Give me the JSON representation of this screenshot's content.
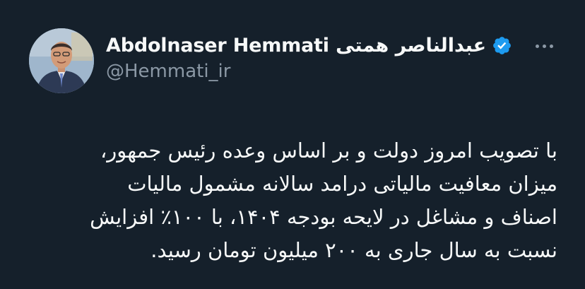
{
  "author": {
    "display_name": "Abdolnaser Hemmati عبدالناصر همتی",
    "handle": "@Hemmati_ir",
    "verified_icon": "verified-badge-icon",
    "avatar_icon": "profile-photo"
  },
  "menu": {
    "more_icon": "more-horizontal-icon"
  },
  "tweet": {
    "lines": [
      "با تصویب امروز دولت و بر اساس وعده رئیس جمهور،",
      "میزان معافیت مالیاتی درامد سالانه مشمول مالیات",
      "اصناف و مشاغل در لایحه بودجه ۱۴۰۴، با ۱۰۰٪ افزایش",
      "نسبت به سال جاری به ۲۰۰ میلیون تومان رسید."
    ]
  },
  "colors": {
    "background": "#15202b",
    "text": "#f7f9f9",
    "secondary": "#8b98a5",
    "verified": "#1d9bf0"
  }
}
